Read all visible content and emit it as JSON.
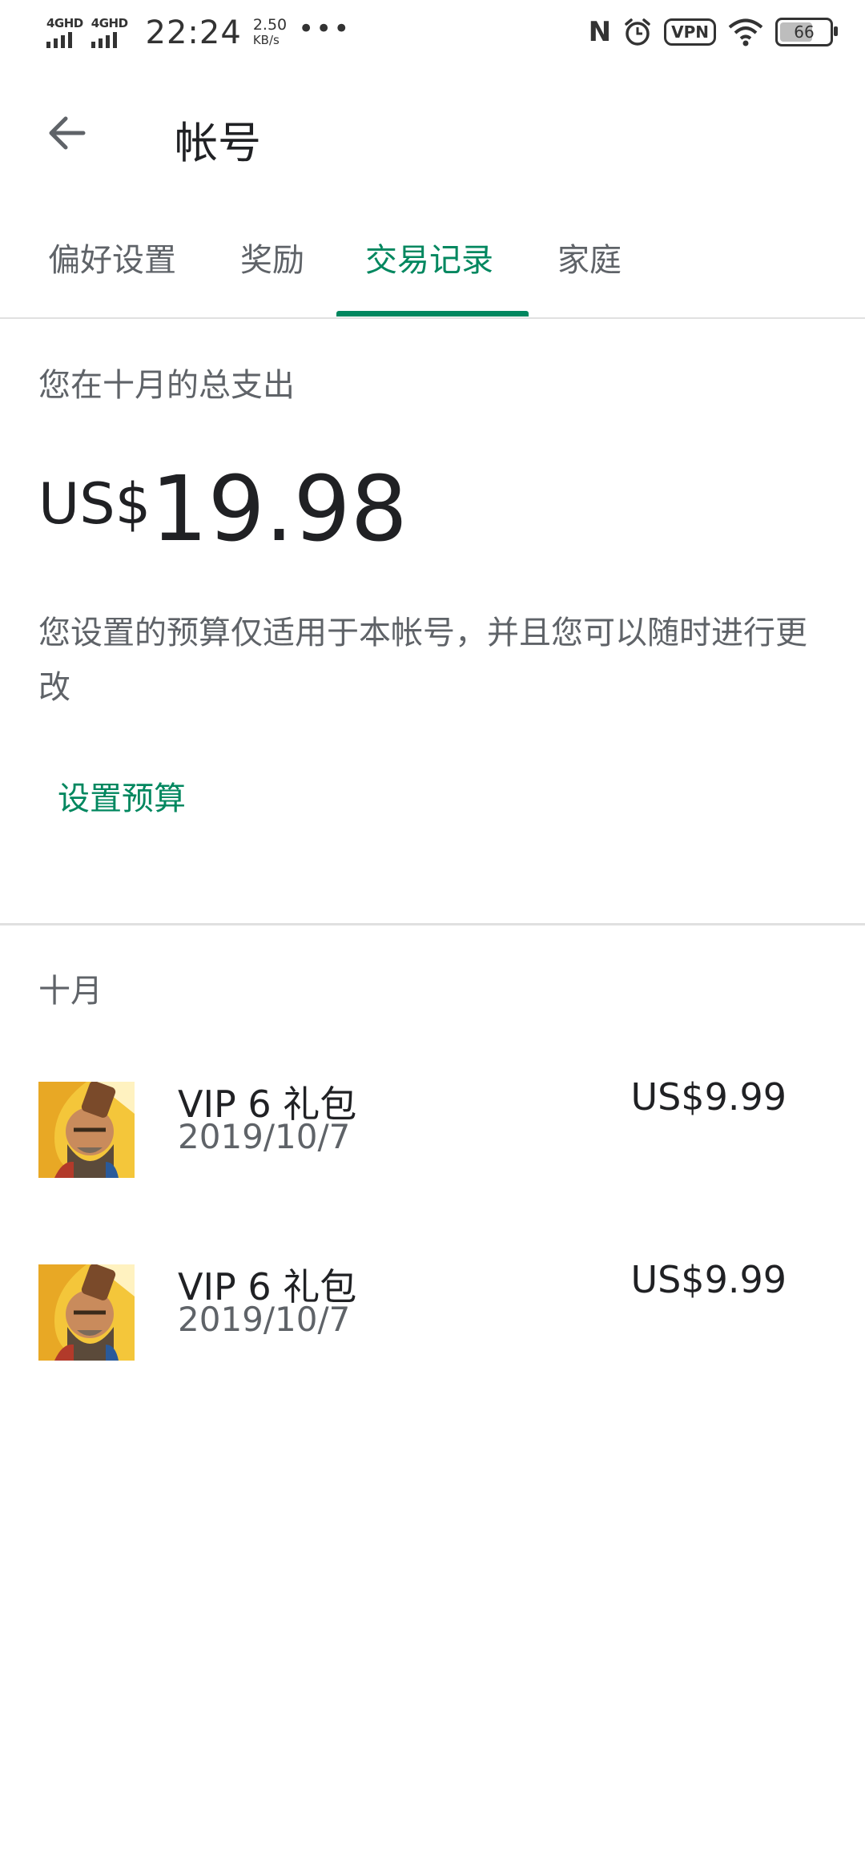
{
  "status_bar": {
    "signal_1": "4GHD",
    "signal_2": "4GHD",
    "time": "22:24",
    "speed_value": "2.50",
    "speed_unit": "KB/s",
    "dots": "•••",
    "nfc": "N",
    "vpn": "VPN",
    "battery": "66"
  },
  "app_bar": {
    "title": "帐号",
    "back_icon": "arrow-left-icon"
  },
  "tabs": [
    {
      "label": "偏好设置",
      "active": false
    },
    {
      "label": "奖励",
      "active": false
    },
    {
      "label": "交易记录",
      "active": true
    },
    {
      "label": "家庭",
      "active": false
    }
  ],
  "summary": {
    "label": "您在十月的总支出",
    "currency": "US$",
    "amount": "19.98",
    "note": "您设置的预算仅适用于本帐号，并且您可以随时进行更改",
    "set_budget": "设置预算"
  },
  "section_title": "十月",
  "transactions": [
    {
      "name": "VIP 6 礼包",
      "date": "2019/10/7",
      "price": "US$9.99",
      "icon": "game-app-icon"
    },
    {
      "name": "VIP 6 礼包",
      "date": "2019/10/7",
      "price": "US$9.99",
      "icon": "game-app-icon"
    }
  ],
  "colors": {
    "accent": "#01875f",
    "text_primary": "#202124",
    "text_secondary": "#5f6368",
    "divider": "#e0e0e0"
  }
}
